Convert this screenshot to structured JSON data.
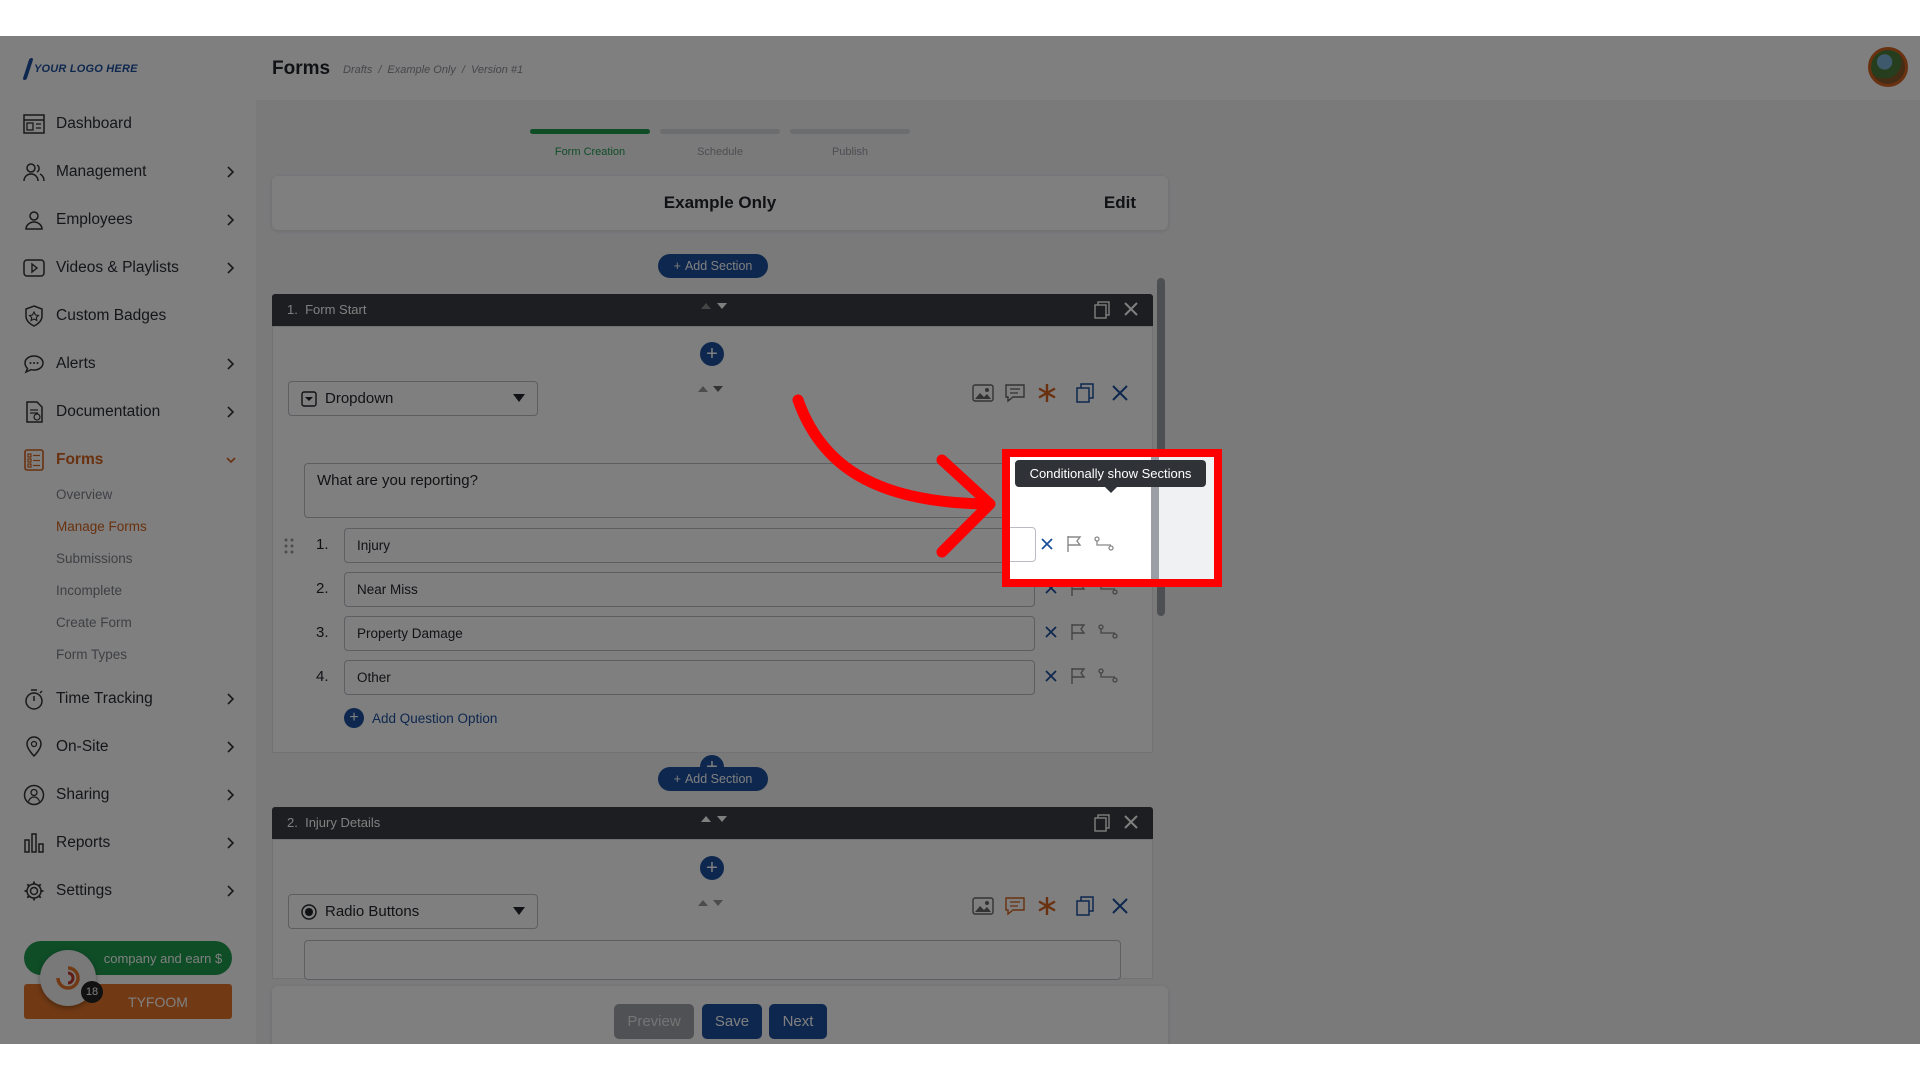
{
  "app": {
    "logo_text": "YOUR LOGO HERE",
    "page_title": "Forms",
    "breadcrumb": [
      "Drafts",
      "/",
      "Example Only",
      "/",
      "Version #1"
    ]
  },
  "sidebar": {
    "items": [
      {
        "label": "Dashboard",
        "icon": "dashboard-icon",
        "chevron": false
      },
      {
        "label": "Management",
        "icon": "management-icon",
        "chevron": true
      },
      {
        "label": "Employees",
        "icon": "employees-icon",
        "chevron": true
      },
      {
        "label": "Videos & Playlists",
        "icon": "video-icon",
        "chevron": true
      },
      {
        "label": "Custom Badges",
        "icon": "badge-icon",
        "chevron": false
      },
      {
        "label": "Alerts",
        "icon": "alert-icon",
        "chevron": true
      },
      {
        "label": "Documentation",
        "icon": "documentation-icon",
        "chevron": true
      },
      {
        "label": "Forms",
        "icon": "forms-icon",
        "chevron": true
      },
      {
        "label": "Time Tracking",
        "icon": "stopwatch-icon",
        "chevron": true
      },
      {
        "label": "On-Site",
        "icon": "location-pin-icon",
        "chevron": true
      },
      {
        "label": "Sharing",
        "icon": "sharing-icon",
        "chevron": true
      },
      {
        "label": "Reports",
        "icon": "reports-icon",
        "chevron": true
      },
      {
        "label": "Settings",
        "icon": "gear-icon",
        "chevron": true
      }
    ],
    "forms_subitems": [
      "Overview",
      "Manage Forms",
      "Submissions",
      "Incomplete",
      "Create Form",
      "Form Types"
    ],
    "refer_text": "company and earn $",
    "tyfoom_label": "TYFOOM",
    "chat_count": "18"
  },
  "steps": [
    {
      "label": "Form Creation",
      "done": true
    },
    {
      "label": "Schedule",
      "done": false
    },
    {
      "label": "Publish",
      "done": false
    }
  ],
  "form": {
    "name": "Example Only",
    "edit_label": "Edit",
    "add_section_label": "Add Section",
    "sections": [
      {
        "number": "1.",
        "title": "Form Start"
      },
      {
        "number": "2.",
        "title": "Injury Details"
      }
    ],
    "question1": {
      "type": "Dropdown",
      "text": "What are you reporting?",
      "options": [
        {
          "num": "1.",
          "value": "Injury"
        },
        {
          "num": "2.",
          "value": "Near Miss"
        },
        {
          "num": "3.",
          "value": "Property Damage"
        },
        {
          "num": "4.",
          "value": "Other"
        }
      ],
      "add_option_label": "Add Question Option"
    },
    "question2": {
      "type": "Radio Buttons"
    }
  },
  "footer": {
    "preview_label": "Preview",
    "save_label": "Save",
    "next_label": "Next"
  },
  "tooltip": {
    "text": "Conditionally show Sections"
  },
  "colors": {
    "brand_blue": "#1c4f9c",
    "accent_orange": "#d2621e",
    "success_green": "#1f9a4e",
    "highlight_red": "#ff0000"
  }
}
